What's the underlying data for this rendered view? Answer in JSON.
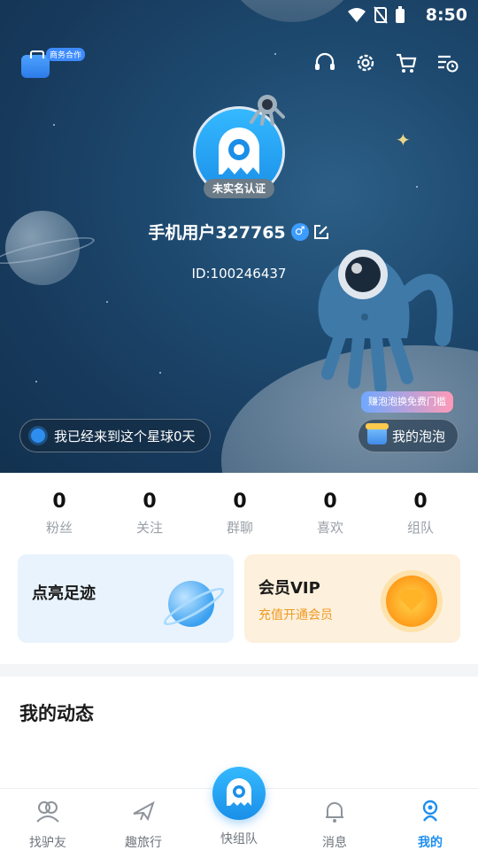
{
  "status": {
    "time": "8:50"
  },
  "header": {
    "business_tag": "商务合作"
  },
  "profile": {
    "avatar_badge": "未实名认证",
    "username": "手机用户327765",
    "gender_symbol": "♂",
    "user_id": "ID:100246437"
  },
  "planet_days_label": "我已经来到这个星球0天",
  "bubble_tip": "赚泡泡换免费门槛",
  "my_bubble_label": "我的泡泡",
  "stats": [
    {
      "value": "0",
      "label": "粉丝"
    },
    {
      "value": "0",
      "label": "关注"
    },
    {
      "value": "0",
      "label": "群聊"
    },
    {
      "value": "0",
      "label": "喜欢"
    },
    {
      "value": "0",
      "label": "组队"
    }
  ],
  "cards": {
    "footprint": {
      "title": "点亮足迹"
    },
    "vip": {
      "title": "会员VIP",
      "subtitle": "充值开通会员"
    }
  },
  "feed": {
    "title": "我的动态"
  },
  "tabs": [
    {
      "label": "找驴友",
      "icon": "friends-icon"
    },
    {
      "label": "趣旅行",
      "icon": "plane-icon"
    },
    {
      "label": "快组队",
      "icon": "mascot-icon"
    },
    {
      "label": "消息",
      "icon": "bell-icon"
    },
    {
      "label": "我的",
      "icon": "profile-icon"
    }
  ],
  "colors": {
    "accent": "#1e8ff0",
    "vip_orange": "#f09a24"
  }
}
